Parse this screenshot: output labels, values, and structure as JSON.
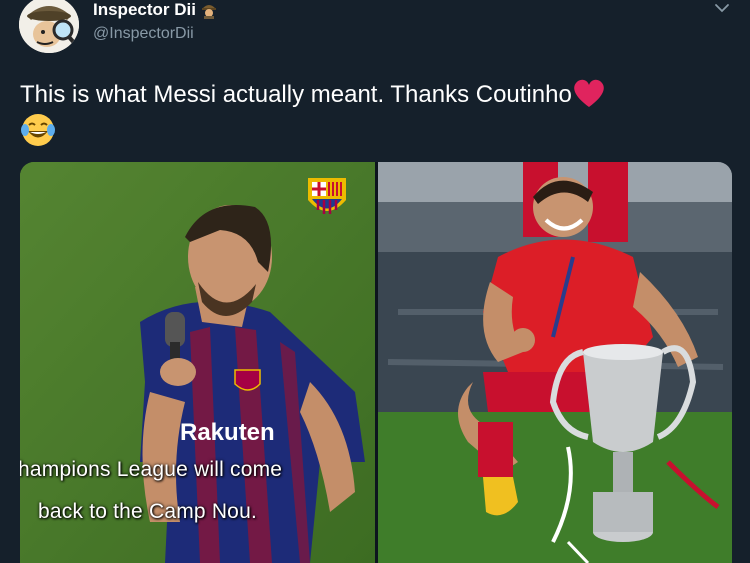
{
  "author": {
    "display_name": "Inspector Dii",
    "handle": "@InspectorDii"
  },
  "tweet": {
    "text": "This is what Messi actually meant. Thanks Coutinho"
  },
  "media": {
    "left_image": {
      "jersey_sponsor": "Rakuten",
      "subtitle_line1": "hampions League will come",
      "subtitle_line2": "back to the Camp Nou."
    }
  },
  "icons": [
    "avatar",
    "detective-emoji-icon",
    "chevron-down-icon",
    "red-heart-icon",
    "tears-of-joy-icon",
    "fc-barcelona-crest-icon"
  ],
  "colors": {
    "background": "#15202b",
    "secondary_text": "#8899a6",
    "heart": "#e0245e"
  }
}
